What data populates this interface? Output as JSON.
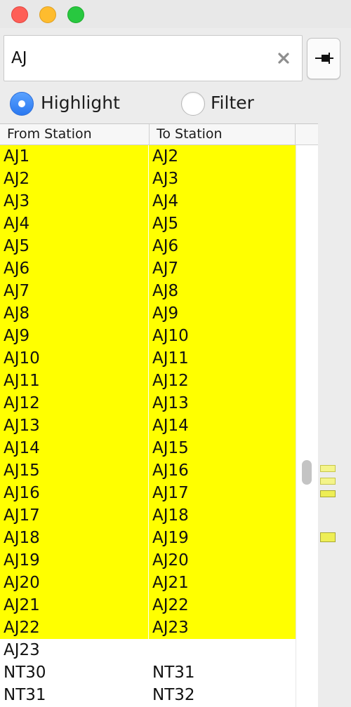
{
  "window": {
    "controls": [
      "close",
      "minimize",
      "zoom"
    ]
  },
  "search": {
    "value": "AJ",
    "clear_icon": "close-x-icon",
    "pin_icon": "pin-icon"
  },
  "mode": {
    "options": [
      {
        "label": "Highlight",
        "selected": true
      },
      {
        "label": "Filter",
        "selected": false
      }
    ]
  },
  "table": {
    "columns": [
      "From Station",
      "To Station"
    ],
    "highlight_color": "#ffff00",
    "rows": [
      {
        "from": "AJ1",
        "to": "AJ2",
        "highlighted": true
      },
      {
        "from": "AJ2",
        "to": "AJ3",
        "highlighted": true
      },
      {
        "from": "AJ3",
        "to": "AJ4",
        "highlighted": true
      },
      {
        "from": "AJ4",
        "to": "AJ5",
        "highlighted": true
      },
      {
        "from": "AJ5",
        "to": "AJ6",
        "highlighted": true
      },
      {
        "from": "AJ6",
        "to": "AJ7",
        "highlighted": true
      },
      {
        "from": "AJ7",
        "to": "AJ8",
        "highlighted": true
      },
      {
        "from": "AJ8",
        "to": "AJ9",
        "highlighted": true
      },
      {
        "from": "AJ9",
        "to": "AJ10",
        "highlighted": true
      },
      {
        "from": "AJ10",
        "to": "AJ11",
        "highlighted": true
      },
      {
        "from": "AJ11",
        "to": "AJ12",
        "highlighted": true
      },
      {
        "from": "AJ12",
        "to": "AJ13",
        "highlighted": true
      },
      {
        "from": "AJ13",
        "to": "AJ14",
        "highlighted": true
      },
      {
        "from": "AJ14",
        "to": "AJ15",
        "highlighted": true
      },
      {
        "from": "AJ15",
        "to": "AJ16",
        "highlighted": true
      },
      {
        "from": "AJ16",
        "to": "AJ17",
        "highlighted": true
      },
      {
        "from": "AJ17",
        "to": "AJ18",
        "highlighted": true
      },
      {
        "from": "AJ18",
        "to": "AJ19",
        "highlighted": true
      },
      {
        "from": "AJ19",
        "to": "AJ20",
        "highlighted": true
      },
      {
        "from": "AJ20",
        "to": "AJ21",
        "highlighted": true
      },
      {
        "from": "AJ21",
        "to": "AJ22",
        "highlighted": true
      },
      {
        "from": "AJ22",
        "to": "AJ23",
        "highlighted": true
      },
      {
        "from": "AJ23",
        "to": "",
        "highlighted": false
      },
      {
        "from": "NT30",
        "to": "NT31",
        "highlighted": false
      },
      {
        "from": "NT31",
        "to": "NT32",
        "highlighted": false
      }
    ]
  },
  "match_markers": {
    "color": "#f4f48a",
    "count": 4
  }
}
